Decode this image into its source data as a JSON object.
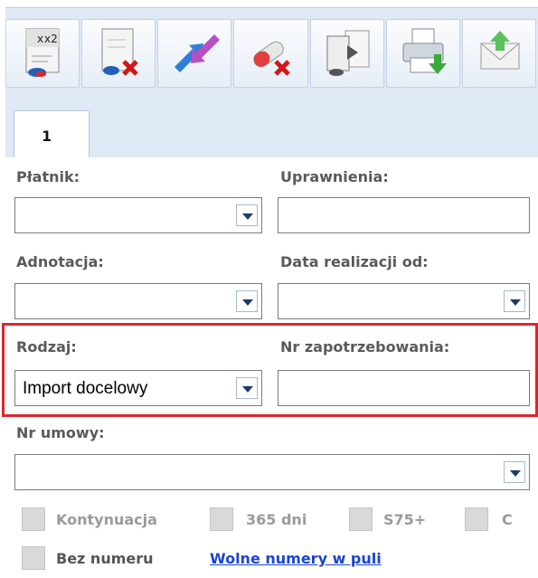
{
  "toolbar": {
    "buttons": [
      {
        "name": "duplicate-prescription",
        "badge": "x2"
      },
      {
        "name": "delete-document"
      },
      {
        "name": "swap-transfer"
      },
      {
        "name": "delete-medication"
      },
      {
        "name": "export-document"
      },
      {
        "name": "print-document"
      },
      {
        "name": "send-mail"
      }
    ]
  },
  "tabs": [
    {
      "label": "1",
      "active": true
    }
  ],
  "form": {
    "platnik": {
      "label": "Płatnik:",
      "value": ""
    },
    "uprawnienia": {
      "label": "Uprawnienia:",
      "value": ""
    },
    "adnotacja": {
      "label": "Adnotacja:",
      "value": ""
    },
    "data_realizacji": {
      "label": "Data realizacji od:",
      "value": ""
    },
    "rodzaj": {
      "label": "Rodzaj:",
      "value": "Import docelowy"
    },
    "nr_zapotrzebowania": {
      "label": "Nr zapotrzebowania:",
      "value": ""
    },
    "nr_umowy": {
      "label": "Nr umowy:",
      "value": ""
    }
  },
  "checkboxes": [
    {
      "label": "Kontynuacja",
      "checked": false
    },
    {
      "label": "365 dni",
      "checked": false
    },
    {
      "label": "S75+",
      "checked": false
    },
    {
      "label": "C",
      "checked": false
    },
    {
      "label": "Bez numeru",
      "checked": false
    }
  ],
  "link": {
    "label": "Wolne numery w puli"
  },
  "colors": {
    "highlight": "#e0242d",
    "toolbar_bg": "#dfe9f5",
    "link": "#1a44d6"
  }
}
